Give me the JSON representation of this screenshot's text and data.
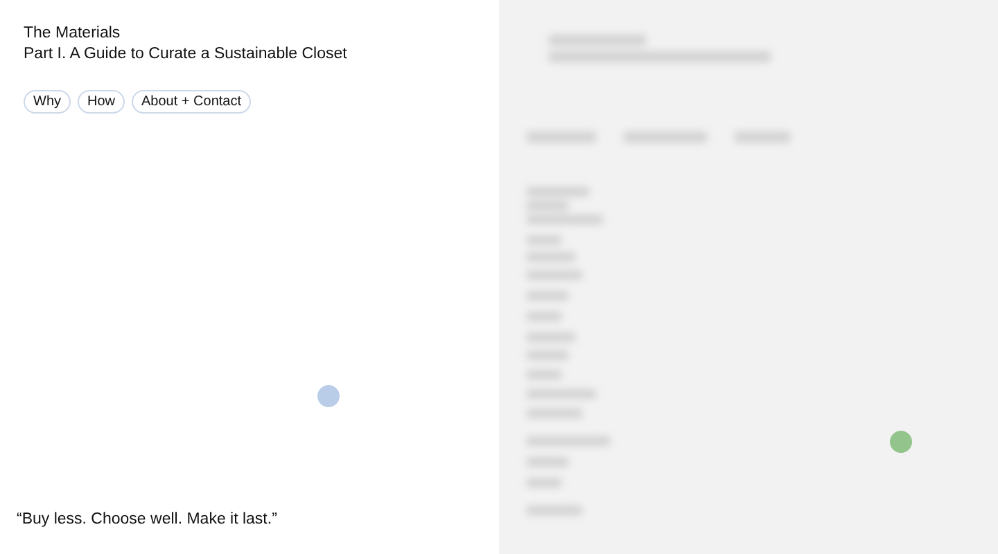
{
  "header": {
    "title": "The Materials",
    "subtitle": "Part I. A Guide to Curate a Sustainable Closet"
  },
  "nav": [
    {
      "label": "Why"
    },
    {
      "label": "How"
    },
    {
      "label": "About + Contact"
    }
  ],
  "quote": "“Buy less. Choose well. Make it last.”",
  "dots": [
    {
      "color": "#b9cde8"
    },
    {
      "color": "#93c48c"
    }
  ]
}
